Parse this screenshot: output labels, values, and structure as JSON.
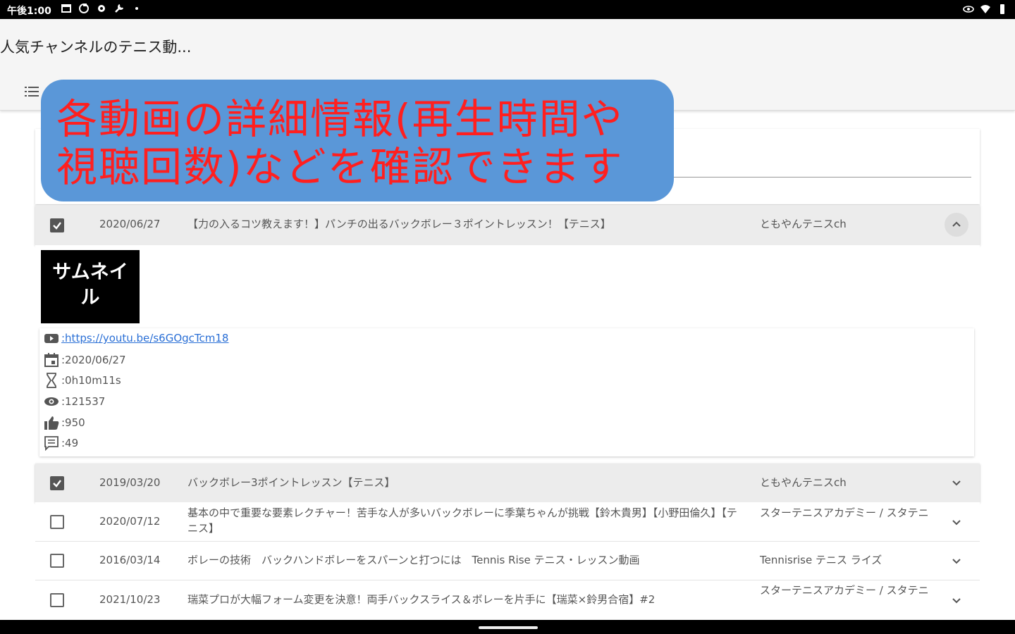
{
  "status_bar": {
    "time": "午後1:00"
  },
  "app_bar": {
    "title": "人気チャンネルのテニス動..."
  },
  "overlay": {
    "line1": "各動画の詳細情報(再生時間や",
    "line2": "視聴回数)などを確認できます"
  },
  "expanded_video": {
    "checked": true,
    "date": "2020/06/27",
    "title": "【力の入るコツ教えます！】パンチの出るバックボレー３ポイントレッスン！【テニス】",
    "channel": "ともやんテニスch",
    "thumbnail_label": "サムネイル",
    "details": {
      "url": ":https://youtu.be/s6GOgcTcm18",
      "published": ":2020/06/27",
      "duration": ":0h10m11s",
      "views": ":121537",
      "likes": ":950",
      "comments": ":49"
    }
  },
  "videos": [
    {
      "checked": true,
      "date": "2019/03/20",
      "title": "バックボレー3ポイントレッスン【テニス】",
      "channel": "ともやんテニスch"
    },
    {
      "checked": false,
      "date": "2020/07/12",
      "title": "基本の中で重要な要素レクチャー！苦手な人が多いバックボレーに季葉ちゃんが挑戦【鈴木貴男】【小野田倫久】【テニス】",
      "channel": "スターテニスアカデミー / スタテニ"
    },
    {
      "checked": false,
      "date": "2016/03/14",
      "title": "ボレーの技術　バックハンドボレーをスパーンと打つには　Tennis Rise テニス・レッスン動画",
      "channel": "Tennisrise テニス ライズ"
    },
    {
      "checked": false,
      "date": "2021/10/23",
      "title": "瑞菜プロが大幅フォーム変更を決意！両手バックスライス＆ボレーを片手に【瑞菜×鈴男合宿】#2",
      "channel": "スターテニスアカデミー / スタテニ"
    }
  ],
  "icons": {
    "menu": "menu-icon",
    "youtube": "youtube-icon",
    "calendar": "calendar-icon",
    "hourglass": "hourglass-icon",
    "eye": "eye-icon",
    "thumb_up": "thumb-up-icon",
    "comment": "comment-icon"
  },
  "colors": {
    "overlay_bg": "#5a97d8",
    "overlay_text": "#ff1f1f",
    "link": "#2a6fd6"
  }
}
